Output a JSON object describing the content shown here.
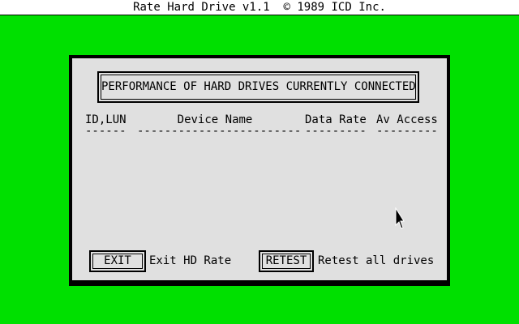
{
  "window": {
    "title": "Rate Hard Drive v1.1  © 1989 ICD Inc."
  },
  "dialog": {
    "heading": "PERFORMANCE OF HARD DRIVES CURRENTLY CONNECTED",
    "columns": [
      {
        "label": "ID,LUN",
        "underline": "------"
      },
      {
        "label": "Device Name",
        "underline": "------------------------"
      },
      {
        "label": "Data Rate",
        "underline": "---------"
      },
      {
        "label": "Av Access",
        "underline": "---------"
      }
    ],
    "exit_button": {
      "label": "EXIT",
      "description": "Exit HD Rate"
    },
    "retest_button": {
      "label": "RETEST",
      "description": "Retest all drives"
    }
  },
  "colors": {
    "desktop": "#00e000",
    "dialog_bg": "#e0e0e0",
    "title_bg": "#ffffff"
  },
  "icons": {
    "cursor": "mouse-pointer-icon"
  }
}
